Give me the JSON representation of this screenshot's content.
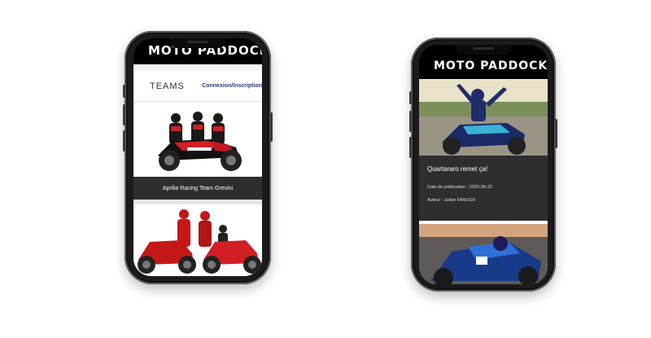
{
  "app": {
    "brand": "MOTO PADDOCK"
  },
  "teams_screen": {
    "section_title": "TEAMS",
    "auth_link": "Connexion/Inscription",
    "cards": [
      {
        "caption": "Aprilia Racing Team Gresini"
      },
      {
        "caption": ""
      }
    ]
  },
  "news_screen": {
    "article": {
      "title": "Quartararo remet ça!",
      "date_label": "Date de publication : 2020-08-20",
      "author_label": "Auteur : Julien FANOUX"
    }
  },
  "colors": {
    "header_bg": "#000000",
    "caption_bg": "#2e2e2e",
    "link_color": "#2b3a73",
    "phone_body": "#1b1b1d"
  }
}
